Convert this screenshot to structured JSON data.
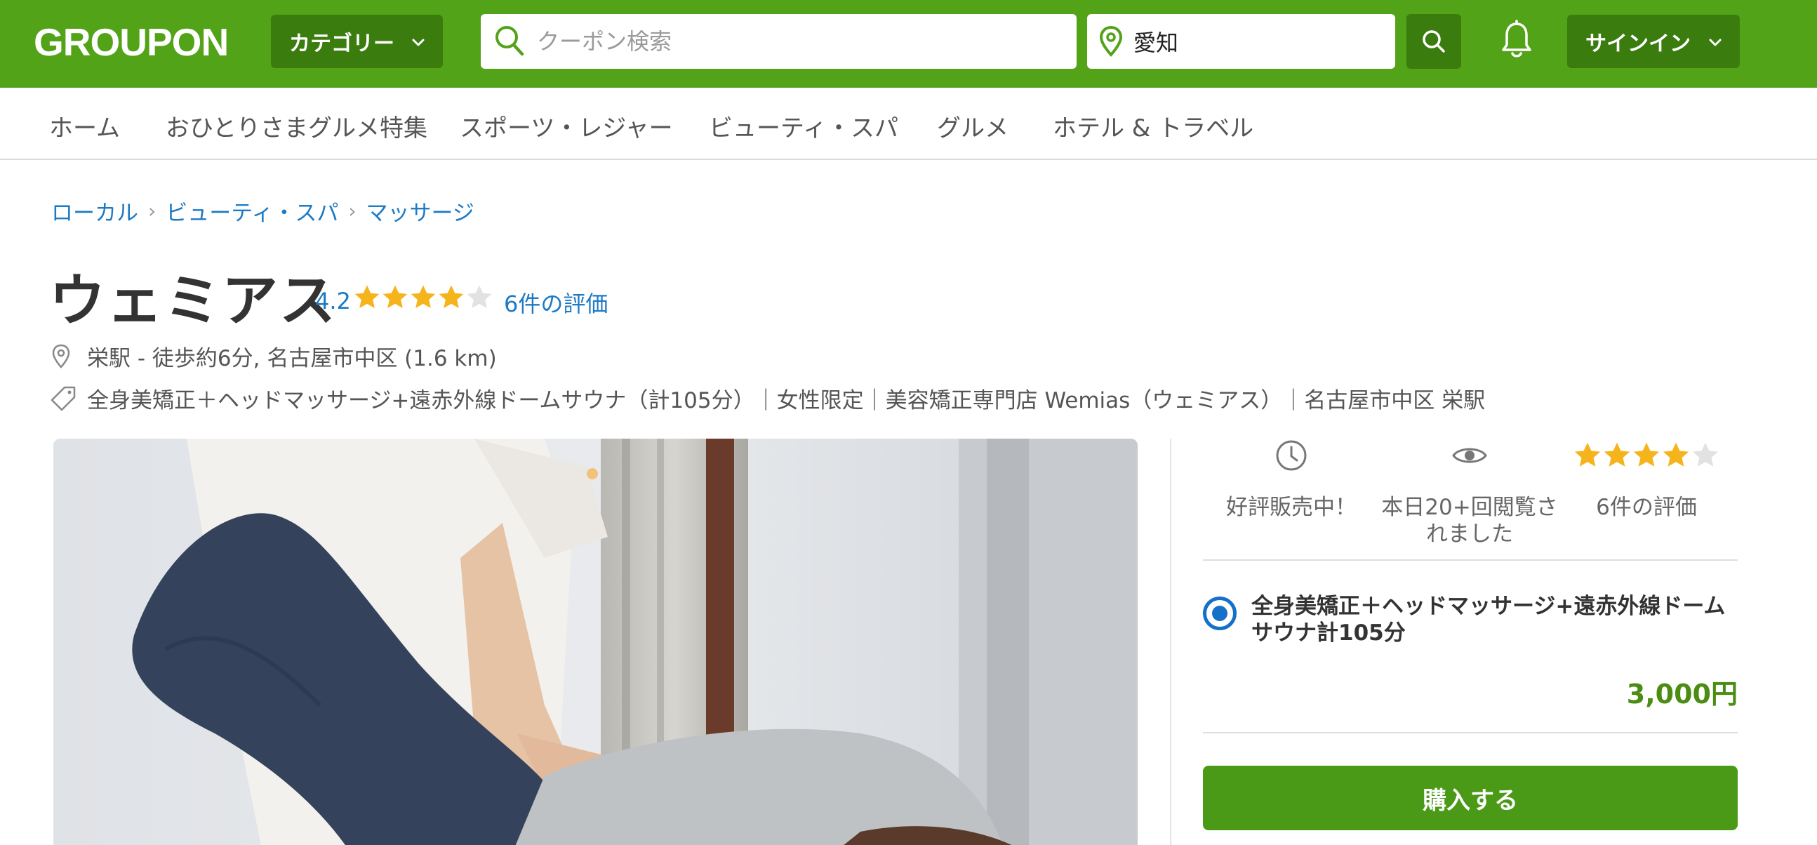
{
  "header": {
    "logo": "GROUPON",
    "category_label": "カテゴリー",
    "search_placeholder": "クーポン検索",
    "location_value": "愛知",
    "signin_label": "サインイン",
    "brand_color": "#53a318",
    "dark_green": "#3b7c0f"
  },
  "nav": {
    "items": [
      "ホーム",
      "おひとりさまグルメ特集",
      "スポーツ・レジャー",
      "ビューティ・スパ",
      "グルメ",
      "ホテル & トラベル"
    ]
  },
  "breadcrumb": [
    "ローカル",
    "ビューティ・スパ",
    "マッサージ"
  ],
  "deal": {
    "title": "ウェミアス",
    "rating": "4.2",
    "stars_filled": 4,
    "stars_total": 5,
    "reviews_link": "6件の評価",
    "address": "栄駅 - 徒歩約6分, 名古屋市中区 (1.6 km)",
    "tagline": "全身美矯正＋ヘッドマッサージ+遠赤外線ドームサウナ（計105分）｜女性限定｜美容矯正専門店 Wemias（ウェミアス）｜名古屋市中区 栄駅"
  },
  "panel": {
    "stat_selling": "好評販売中！",
    "stat_views": "本日20+回閲覧されました",
    "stat_reviews": "6件の評価",
    "option_label": "全身美矯正＋ヘッドマッサージ+遠赤外線ドームサウナ計105分",
    "price": "3,000円",
    "buy_label": "購入する",
    "price_color": "#4a8d12",
    "accent_blue": "#1570c9"
  },
  "icons": [
    "search-icon",
    "location-pin-icon",
    "bell-icon",
    "chevron-down-icon",
    "tag-icon",
    "clock-icon",
    "eye-icon",
    "star-icon"
  ]
}
